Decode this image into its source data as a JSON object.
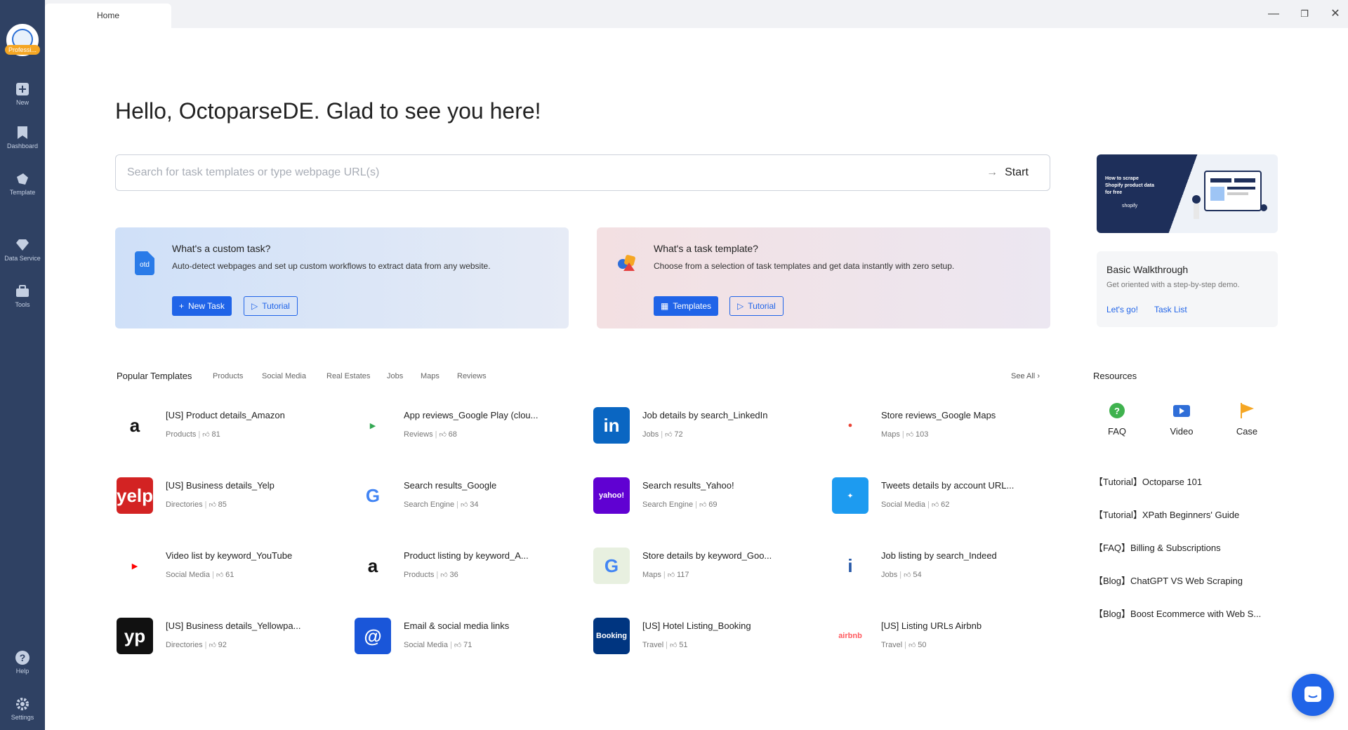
{
  "sidebar": {
    "plan_badge": "Professi...",
    "items": [
      {
        "label": "New",
        "icon": "plus-square-icon"
      },
      {
        "label": "Dashboard",
        "icon": "bookmark-icon"
      },
      {
        "label": "Template",
        "icon": "template-icon"
      },
      {
        "label": "Data Service",
        "icon": "diamond-icon"
      },
      {
        "label": "Tools",
        "icon": "toolbox-icon"
      },
      {
        "label": "Help",
        "icon": "help-icon"
      },
      {
        "label": "Settings",
        "icon": "gear-icon"
      }
    ]
  },
  "tabbar": {
    "active_tab": "Home"
  },
  "main": {
    "greeting": "Hello, OctoparseDE. Glad to see you here!",
    "search": {
      "placeholder": "Search for task templates or type webpage URL(s)",
      "value": "",
      "start_label": "Start"
    },
    "cards": [
      {
        "title": "What's a custom task?",
        "desc": "Auto-detect webpages and set up custom workflows to extract data from any website.",
        "primary": "New Task",
        "secondary": "Tutorial"
      },
      {
        "title": "What's a task template?",
        "desc": "Choose from a selection of task templates and get data instantly with zero setup.",
        "primary": "Templates",
        "secondary": "Tutorial"
      }
    ],
    "banner": {
      "text": "How to scrape Shopify product data for free",
      "brand": "shopify"
    },
    "walkthrough": {
      "title": "Basic Walkthrough",
      "desc": "Get oriented with a step-by-step demo.",
      "lets_go": "Let's go!",
      "task_list": "Task List"
    }
  },
  "templates": {
    "heading": "Popular Templates",
    "tabs": [
      "Products",
      "Social Media",
      "Real Estates",
      "Jobs",
      "Maps",
      "Reviews"
    ],
    "see_all": "See All",
    "items": [
      {
        "name": "[US] Product details_Amazon",
        "category": "Products",
        "likes": "81",
        "logo": "amazon-logo"
      },
      {
        "name": "App reviews_Google Play (clou...",
        "category": "Reviews",
        "likes": "68",
        "logo": "google-play-logo"
      },
      {
        "name": "Job details by search_LinkedIn",
        "category": "Jobs",
        "likes": "72",
        "logo": "linkedin-logo"
      },
      {
        "name": "Store reviews_Google Maps",
        "category": "Maps",
        "likes": "103",
        "logo": "google-maps-pin-logo"
      },
      {
        "name": "[US] Business details_Yelp",
        "category": "Directories",
        "likes": "85",
        "logo": "yelp-logo"
      },
      {
        "name": "Search results_Google",
        "category": "Search Engine",
        "likes": "34",
        "logo": "google-logo"
      },
      {
        "name": "Search results_Yahoo!",
        "category": "Search Engine",
        "likes": "69",
        "logo": "yahoo-logo"
      },
      {
        "name": "Tweets details by account URL...",
        "category": "Social Media",
        "likes": "62",
        "logo": "twitter-logo"
      },
      {
        "name": "Video list by keyword_YouTube",
        "category": "Social Media",
        "likes": "61",
        "logo": "youtube-logo"
      },
      {
        "name": "Product listing by keyword_A...",
        "category": "Products",
        "likes": "36",
        "logo": "amazon-logo"
      },
      {
        "name": "Store details by keyword_Goo...",
        "category": "Maps",
        "likes": "117",
        "logo": "google-maps-logo"
      },
      {
        "name": "Job listing by search_Indeed",
        "category": "Jobs",
        "likes": "54",
        "logo": "indeed-logo"
      },
      {
        "name": "[US] Business details_Yellowpa...",
        "category": "Directories",
        "likes": "92",
        "logo": "yellowpages-logo"
      },
      {
        "name": "Email & social media links",
        "category": "Social Media",
        "likes": "71",
        "logo": "email-logo"
      },
      {
        "name": "[US] Hotel Listing_Booking",
        "category": "Travel",
        "likes": "51",
        "logo": "booking-logo"
      },
      {
        "name": "[US] Listing URLs Airbnb",
        "category": "Travel",
        "likes": "50",
        "logo": "airbnb-logo"
      }
    ]
  },
  "resources": {
    "heading": "Resources",
    "quick": [
      {
        "label": "FAQ",
        "icon": "question-icon"
      },
      {
        "label": "Video",
        "icon": "video-icon"
      },
      {
        "label": "Case",
        "icon": "flag-icon"
      }
    ],
    "links": [
      "【Tutorial】Octoparse 101",
      "【Tutorial】XPath Beginners' Guide",
      "【FAQ】Billing & Subscriptions",
      "【Blog】ChatGPT VS Web Scraping",
      "【Blog】Boost Ecommerce with Web S..."
    ]
  },
  "colors": {
    "sidebar": "#2f4163",
    "accent": "#2064e8"
  }
}
